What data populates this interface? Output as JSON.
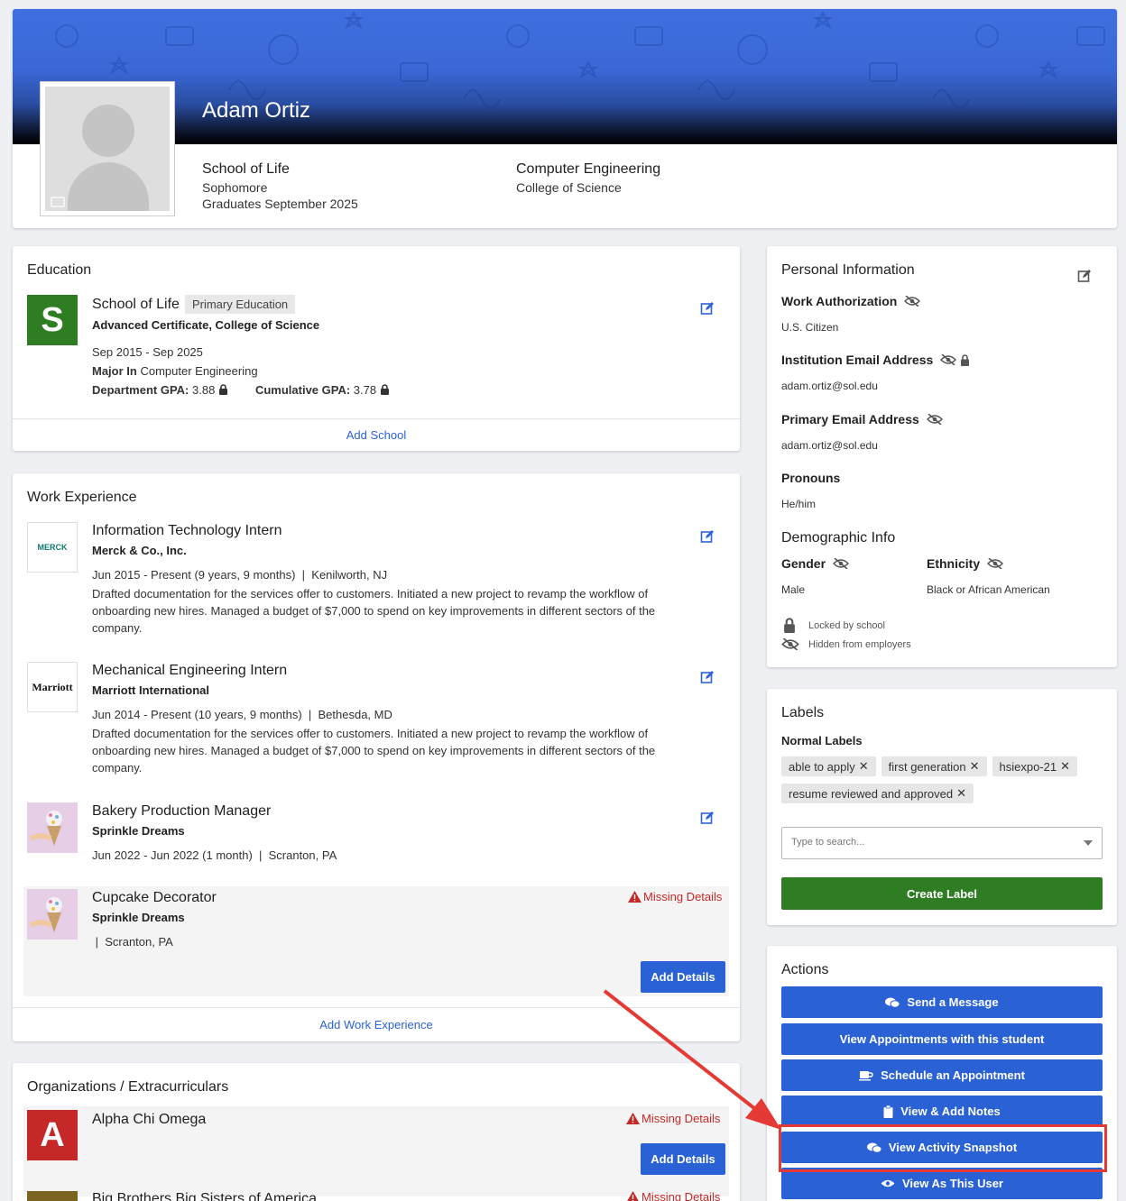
{
  "profile": {
    "name": "Adam Ortiz",
    "school": "School of Life",
    "year": "Sophomore",
    "graduation": "Graduates September 2025",
    "major": "Computer Engineering",
    "college": "College of Science"
  },
  "education": {
    "heading": "Education",
    "school_name": "School of Life",
    "badge": "Primary Education",
    "logo_letter": "S",
    "degree": "Advanced Certificate, College of Science",
    "dates": "Sep 2015 - Sep 2025",
    "major_label": "Major In",
    "major_value": "Computer Engineering",
    "dept_gpa_label": "Department GPA:",
    "dept_gpa": "3.88",
    "cum_gpa_label": "Cumulative GPA:",
    "cum_gpa": "3.78",
    "add_link": "Add School"
  },
  "work": {
    "heading": "Work Experience",
    "jobs": [
      {
        "title": "Information Technology Intern",
        "company": "Merck & Co., Inc.",
        "meta": "Jun 2015 - Present (9 years, 9 months)  |  Kenilworth, NJ",
        "desc": "Drafted documentation for the services offer to customers. Initiated a new project to revamp the workflow of onboarding new hires. Managed a budget of $7,000 to spend on key improvements in different sectors of the company.",
        "logo": "MERCK"
      },
      {
        "title": "Mechanical Engineering Intern",
        "company": "Marriott International",
        "meta": "Jun 2014 - Present (10 years, 9 months)  |  Bethesda, MD",
        "desc": "Drafted documentation for the services offer to customers. Initiated a new project to revamp the workflow of onboarding new hires. Managed a budget of $7,000 to spend on key improvements in different sectors of the company.",
        "logo": "Marriott"
      },
      {
        "title": "Bakery Production Manager",
        "company": "Sprinkle Dreams",
        "meta": "Jun 2022 - Jun 2022 (1 month)  |  Scranton, PA"
      },
      {
        "title": "Cupcake Decorator",
        "company": "Sprinkle Dreams",
        "meta": " |  Scranton, PA"
      }
    ],
    "missing": "Missing Details",
    "add_details": "Add Details",
    "add_link": "Add Work Experience"
  },
  "orgs": {
    "heading": "Organizations / Extracurriculars",
    "items": [
      {
        "name": "Alpha Chi Omega",
        "logo_letter": "A"
      },
      {
        "name": "Big Brothers Big Sisters of America"
      }
    ],
    "missing": "Missing Details",
    "add_details": "Add Details"
  },
  "personal": {
    "heading": "Personal Information",
    "work_auth_label": "Work Authorization",
    "work_auth": "U.S. Citizen",
    "inst_email_label": "Institution Email Address",
    "inst_email": "adam.ortiz@sol.edu",
    "primary_email_label": "Primary Email Address",
    "primary_email": "adam.ortiz@sol.edu",
    "pronouns_label": "Pronouns",
    "pronouns": "He/him",
    "demo_heading": "Demographic Info",
    "gender_label": "Gender",
    "gender": "Male",
    "ethnicity_label": "Ethnicity",
    "ethnicity": "Black or African American",
    "legend_locked": "Locked by school",
    "legend_hidden": "Hidden from employers"
  },
  "labels": {
    "heading": "Labels",
    "sub": "Normal Labels",
    "chips": [
      "able to apply",
      "first generation",
      "hsiexpo-21",
      "resume reviewed and approved"
    ],
    "search_placeholder": "Type to search...",
    "create": "Create Label"
  },
  "actions": {
    "heading": "Actions",
    "buttons": [
      "Send a Message",
      "View Appointments with this student",
      "Schedule an Appointment",
      "View & Add Notes",
      "View Activity Snapshot",
      "View As This User"
    ]
  },
  "colors": {
    "brand_blue": "#2a62d6",
    "green": "#2e7d22",
    "danger": "#c62828",
    "highlight": "#e53935"
  }
}
